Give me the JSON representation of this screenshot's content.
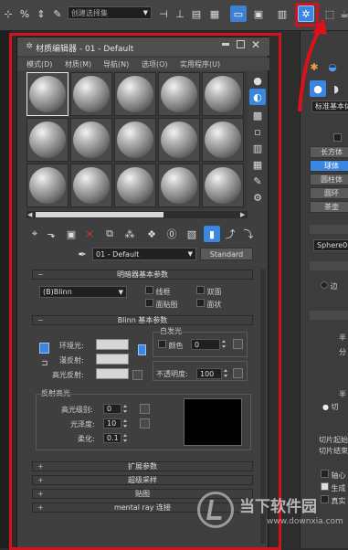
{
  "toolbar": {
    "selection_set_placeholder": "创建选择集"
  },
  "material_editor": {
    "title": "材质编辑器 - 01 - Default",
    "menu": [
      "模式(D)",
      "材质(M)",
      "导航(N)",
      "选项(O)",
      "实用程序(U)"
    ],
    "material_name": "01 - Default",
    "material_type": "Standard",
    "shader_rollout": {
      "title": "明暗器基本参数",
      "shader": "(B)Blinn",
      "wire": "线框",
      "two_sided": "双面",
      "face_map": "面贴图",
      "faceted": "面状"
    },
    "blinn_rollout": {
      "title": "Blinn 基本参数",
      "self_illum_group": "自发光",
      "color_label": "颜色",
      "color_value": "0",
      "ambient": "环境光:",
      "diffuse": "漫反射:",
      "specular": "高光反射:",
      "opacity_label": "不透明度:",
      "opacity_value": "100",
      "spec_highlights_group": "反射高光",
      "spec_level_label": "高光级别:",
      "spec_level_value": "0",
      "glossiness_label": "光泽度:",
      "glossiness_value": "10",
      "soften_label": "柔化:",
      "soften_value": "0.1"
    },
    "collapsed_rollouts": [
      "扩展参数",
      "超级采样",
      "贴图",
      "mental ray 连接"
    ]
  },
  "command_panel": {
    "category_dropdown": "标准基本体",
    "object_buttons": [
      "长方体",
      "球体",
      "圆柱体",
      "圆环",
      "茶壶"
    ],
    "object_name": "Sphere001",
    "labels": [
      "边",
      "半",
      "分",
      "半",
      "切片起始",
      "切片结束",
      "轴心",
      "生成",
      "真实"
    ],
    "radio_label": "切"
  },
  "watermark": {
    "text_cn": "当下软件园",
    "text_url": "www.downxia.com"
  },
  "colors": {
    "highlight_border": "#d0131c",
    "arrow": "#e0101a",
    "accent_blue": "#2a78d8"
  }
}
